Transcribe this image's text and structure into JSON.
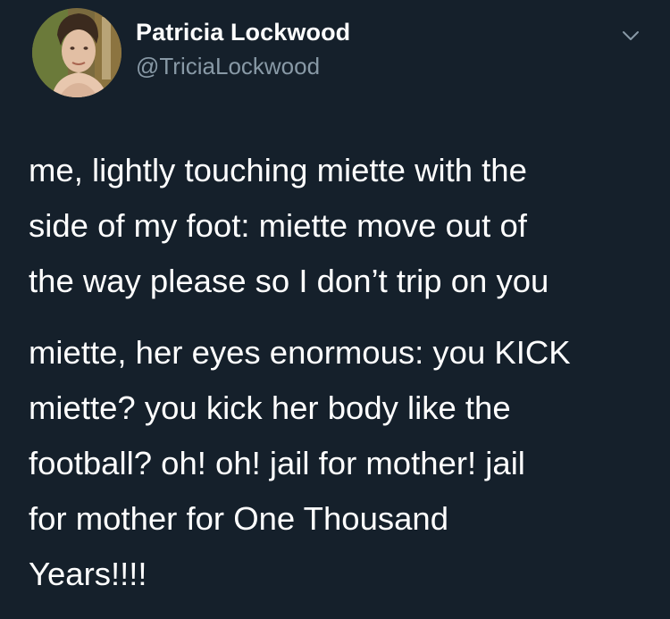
{
  "author": {
    "display_name": "Patricia Lockwood",
    "handle": "@TriciaLockwood"
  },
  "header": {
    "menu_icon": "chevron-down-icon"
  },
  "tweet": {
    "paragraphs": [
      {
        "lines": [
          "me, lightly touching miette with the",
          "side of my foot: miette move out of",
          "the way please so I don’t trip on you"
        ]
      },
      {
        "lines": [
          "miette, her eyes enormous: you KICK",
          "miette? you kick her body like the",
          "football? oh! oh! jail for mother! jail",
          "for mother for One Thousand",
          "Years!!!!"
        ]
      }
    ]
  },
  "colors": {
    "background": "#15202b",
    "primary_text": "#ffffff",
    "secondary_text": "#8899a6"
  }
}
